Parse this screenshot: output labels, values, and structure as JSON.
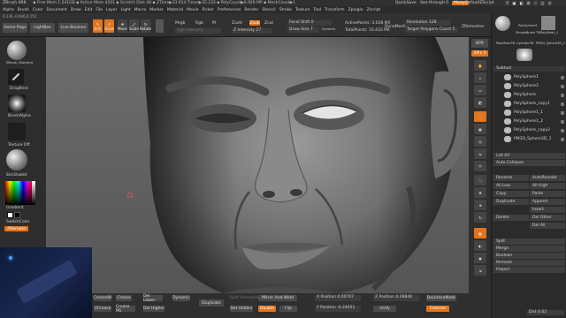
{
  "titlebar": {
    "app": "ZBrush 4R8",
    "info": "▪ Free Mem 1.241GB ▪ Active Mem 4201 ▪ Scratch Disk 48 ▪ ZTime▶33.614 Timer▶35.232 ▪ PolyCount▶0.926 MP ▪ MeshCount▶1",
    "quicksave": "QuickSave",
    "seethrough": "See-through  0",
    "menus_btn": "Menus",
    "script": "DefaultZScript"
  },
  "coords": "0.236,-0.946,0.152",
  "menubar": [
    "Alpha",
    "Brush",
    "Color",
    "Document",
    "Draw",
    "Edit",
    "File",
    "Layer",
    "Light",
    "Macro",
    "Marker",
    "Material",
    "Movie",
    "Picker",
    "Preferences",
    "Render",
    "Stencil",
    "Stroke",
    "Texture",
    "Tool",
    "Transform",
    "Zplugin",
    "Zscript"
  ],
  "toolbar": {
    "home": "Home Page",
    "lightbox": "LightBox",
    "liveboolean": "Live Boolean",
    "edit": "Edit",
    "draw": "Draw",
    "move": "Move",
    "scale": "Scale",
    "rotate": "Rotate",
    "mrgb": "Mrgb",
    "rgb": "Rgb",
    "m": "M",
    "rgb_intensity": "Rgb Intensity",
    "zadd": "Zadd",
    "zsub": "Zsub",
    "zcut": "Zcut",
    "z_intensity": "Z Intensity 27",
    "focal_shift": "Focal Shift 0",
    "draw_size": "Draw Size 7",
    "dynamic": "Dynamic",
    "active_points": "ActivePoints: 3.028 Mil",
    "total_points": "TotalPoints: 10.433 Mil",
    "dynamesh": "DynaMesh",
    "resolution": "Resolution 128",
    "target_polygons": "Target Polygons Count 5",
    "zremesher": "ZRemesher"
  },
  "lefttray": {
    "brush": "ZBrush_Standard",
    "stroke": "DragRect",
    "alpha": "BrushAlpha",
    "texture": "Texture Off",
    "material": "SkinShade4",
    "gradient": "Gradient",
    "switchcolor": "SwitchColor",
    "alternate": "Alternate"
  },
  "rightshelf": [
    "BPR",
    "SPix 3",
    "Scroll",
    "Zoom",
    "Actual",
    "AAHalf",
    "Persp",
    "Floor",
    "Local",
    "L.Sym",
    "Frame",
    "Move",
    "Scale",
    "Rotate",
    "Line Fill",
    "PolyF",
    "Transp",
    "Ghost",
    "Solo",
    "Xpose"
  ],
  "righttray": {
    "tools": [
      "PolySphere2",
      "SimpleBrush",
      "TMPolyMesh_1",
      "PolyMesh3D",
      "Cylinder3D",
      "PM3D_Sphere3D_1"
    ],
    "subtool_header": "Subtool",
    "subtools": [
      "PolySphere1",
      "PolySphere2",
      "PolySphere",
      "PolySphere_copy1",
      "PolySphere1_1",
      "PolySphere1_2",
      "PolySphere_copy2",
      "PM3D_Sphere3D_1"
    ],
    "list_all": "List All",
    "auto_collapse": "Auto Collapse",
    "rename": "Rename",
    "autoreorder": "AutoReorder",
    "all_low": "All Low",
    "all_high": "All High",
    "copy": "Copy",
    "paste": "Paste",
    "duplicate": "Duplicate",
    "append": "Append",
    "insert": "Insert",
    "delete": "Delete",
    "del_other": "Del Other",
    "del_all": "Del All",
    "split": "Split",
    "merge": "Merge",
    "boolean": "Boolean",
    "remesh": "Remesh",
    "project": "Project",
    "dist": "Dist 0.02"
  },
  "bottombar": {
    "crease_all": "CreaseAll",
    "crease": "Crease",
    "del_lower": "Del Lower",
    "dynamic": "Dynamic",
    "duplicate": "Duplicate",
    "split_unmasked": "Split Unmasked",
    "mirror_and_weld": "Mirror And Weld",
    "x_position": "X Position 0.00707",
    "z_position": "Z Position 0.28846",
    "backface_mask": "BackfaceMask",
    "uv_crease": "UCrease",
    "crease_pg": "Crease PG",
    "del_higher": "Del Higher",
    "del_hidden": "Del Hidden",
    "double": "Double",
    "flip": "Flip",
    "y_position": "Y Position -0.24651",
    "unify": "Unify",
    "colorize": "Colorize"
  }
}
